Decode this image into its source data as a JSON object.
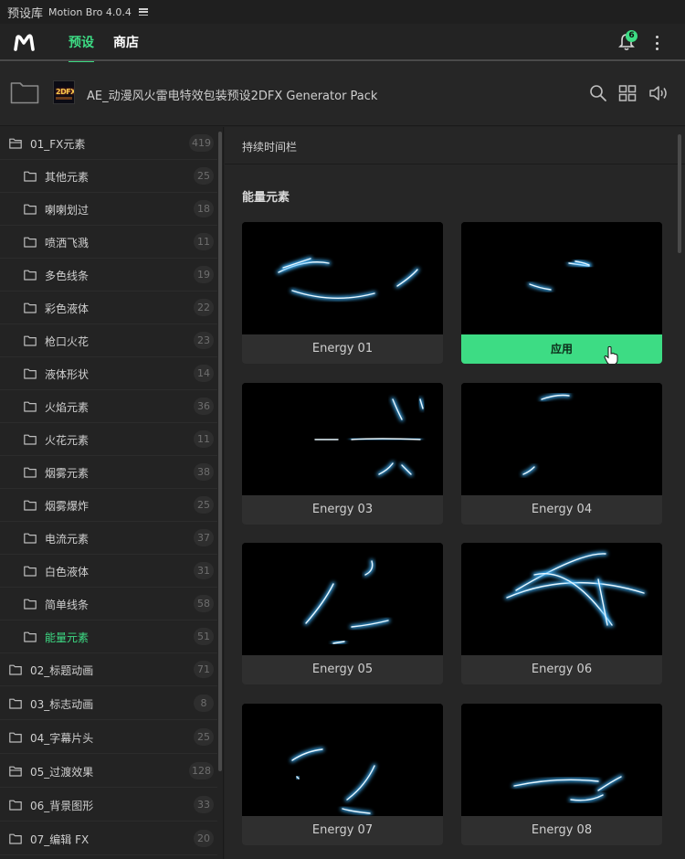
{
  "window": {
    "title": "预设库",
    "app_version": "Motion Bro 4.0.4"
  },
  "header": {
    "tabs": [
      {
        "label": "预设",
        "active": true
      },
      {
        "label": "商店",
        "active": false
      }
    ],
    "notification_count": "6",
    "accent_color": "#3ddc84"
  },
  "pack": {
    "title": "AE_动漫风火雷电特效包装预设2DFX Generator Pack",
    "thumb_text": "2DFX"
  },
  "sidebar": {
    "items": [
      {
        "label": "01_FX元素",
        "count": "419",
        "level": 0,
        "open": true
      },
      {
        "label": "其他元素",
        "count": "25",
        "level": 1
      },
      {
        "label": "喇喇划过",
        "count": "18",
        "level": 1
      },
      {
        "label": "喷洒飞溅",
        "count": "11",
        "level": 1
      },
      {
        "label": "多色线条",
        "count": "19",
        "level": 1
      },
      {
        "label": "彩色液体",
        "count": "22",
        "level": 1
      },
      {
        "label": "枪口火花",
        "count": "23",
        "level": 1
      },
      {
        "label": "液体形状",
        "count": "14",
        "level": 1
      },
      {
        "label": "火焰元素",
        "count": "36",
        "level": 1
      },
      {
        "label": "火花元素",
        "count": "11",
        "level": 1
      },
      {
        "label": "烟雾元素",
        "count": "38",
        "level": 1
      },
      {
        "label": "烟雾爆炸",
        "count": "25",
        "level": 1
      },
      {
        "label": "电流元素",
        "count": "37",
        "level": 1
      },
      {
        "label": "白色液体",
        "count": "31",
        "level": 1
      },
      {
        "label": "简单线条",
        "count": "58",
        "level": 1
      },
      {
        "label": "能量元素",
        "count": "51",
        "level": 1,
        "active": true
      },
      {
        "label": "02_标题动画",
        "count": "71",
        "level": 0
      },
      {
        "label": "03_标志动画",
        "count": "8",
        "level": 0
      },
      {
        "label": "04_字幕片头",
        "count": "25",
        "level": 0
      },
      {
        "label": "05_过渡效果",
        "count": "128",
        "level": 0,
        "open": true
      },
      {
        "label": "06_背景图形",
        "count": "33",
        "level": 0
      },
      {
        "label": "07_编辑 FX",
        "count": "20",
        "level": 0
      }
    ]
  },
  "main": {
    "duration_bar": "持续时间栏",
    "section_title": "能量元素",
    "apply_label": "应用",
    "presets": [
      {
        "name": "Energy 01"
      },
      {
        "name": "Energy 02",
        "hovered": true
      },
      {
        "name": "Energy 03"
      },
      {
        "name": "Energy 04"
      },
      {
        "name": "Energy 05"
      },
      {
        "name": "Energy 06"
      },
      {
        "name": "Energy 07"
      },
      {
        "name": "Energy 08"
      }
    ]
  }
}
